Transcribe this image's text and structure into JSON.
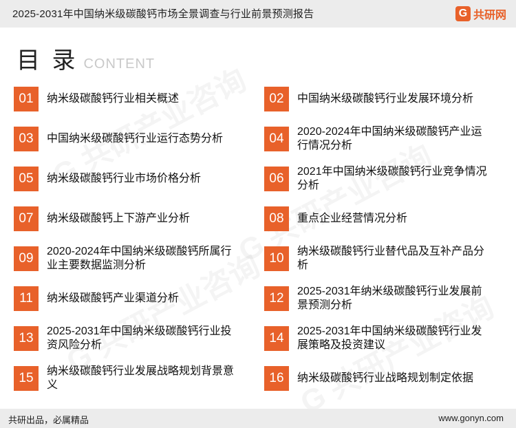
{
  "header": {
    "title": "2025-2031年中国纳米级碳酸钙市场全景调查与行业前景预测报告",
    "logo_text": "共研网",
    "logo_mark": "G"
  },
  "toc": {
    "title": "目 录",
    "subtitle": "CONTENT",
    "items": [
      {
        "num": "01",
        "label": "纳米级碳酸钙行业相关概述"
      },
      {
        "num": "02",
        "label": "中国纳米级碳酸钙行业发展环境分析"
      },
      {
        "num": "03",
        "label": "中国纳米级碳酸钙行业运行态势分析"
      },
      {
        "num": "04",
        "label": "2020-2024年中国纳米级碳酸钙产业运行情况分析"
      },
      {
        "num": "05",
        "label": "纳米级碳酸钙行业市场价格分析"
      },
      {
        "num": "06",
        "label": "2021年中国纳米级碳酸钙行业竞争情况分析"
      },
      {
        "num": "07",
        "label": "纳米级碳酸钙上下游产业分析"
      },
      {
        "num": "08",
        "label": "重点企业经营情况分析"
      },
      {
        "num": "09",
        "label": "2020-2024年中国纳米级碳酸钙所属行业主要数据监测分析"
      },
      {
        "num": "10",
        "label": "纳米级碳酸钙行业替代品及互补产品分析"
      },
      {
        "num": "11",
        "label": "纳米级碳酸钙产业渠道分析"
      },
      {
        "num": "12",
        "label": "2025-2031年纳米级碳酸钙行业发展前景预测分析"
      },
      {
        "num": "13",
        "label": "2025-2031年中国纳米级碳酸钙行业投资风险分析"
      },
      {
        "num": "14",
        "label": "2025-2031年中国纳米级碳酸钙行业发展策略及投资建议"
      },
      {
        "num": "15",
        "label": "纳米级碳酸钙行业发展战略规划背景意义"
      },
      {
        "num": "16",
        "label": "纳米级碳酸钙行业战略规划制定依据"
      }
    ]
  },
  "footer": {
    "slogan": "共研出品，必属精品",
    "url": "www.gonyn.com"
  },
  "colors": {
    "accent": "#e8612a",
    "header_bg": "#ececec"
  }
}
